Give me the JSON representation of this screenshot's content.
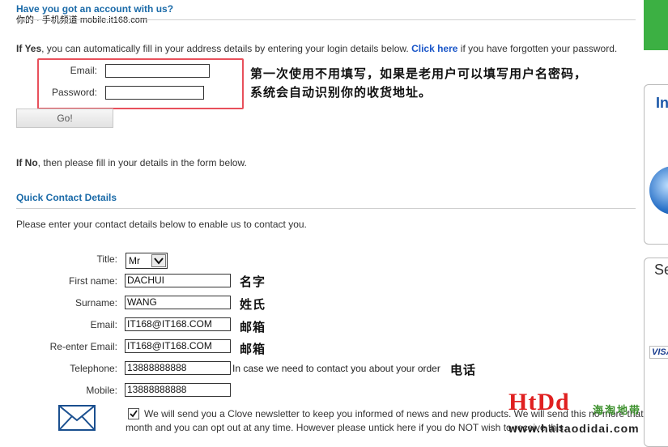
{
  "watermark": "你的 · 手机频道 mobile.it168.com",
  "account": {
    "heading": "Have you got an account with us?",
    "if_yes_bold": "If Yes",
    "if_yes_text": ", you can automatically fill in your address details by entering your login details below.",
    "click_here": "Click here",
    "forgot_text": "if you have forgotten your password.",
    "email_label": "Email:",
    "password_label": "Password:",
    "email_value": "",
    "password_value": "",
    "go_button": "Go!",
    "annotation_line1": "第一次使用不用填写，如果是老用户可以填写用户名密码，",
    "annotation_line2": "系统会自动识别你的收货地址。",
    "if_no_bold": "If No",
    "if_no_text": ", then please fill in your details in the form below."
  },
  "contact": {
    "heading": "Quick Contact Details",
    "intro": "Please enter your contact details below to enable us to contact you.",
    "title_label": "Title:",
    "title_value": "Mr",
    "firstname_label": "First name:",
    "firstname_value": "DACHUI",
    "firstname_note": "名字",
    "surname_label": "Surname:",
    "surname_value": "WANG",
    "surname_note": "姓氏",
    "email_label": "Email:",
    "email_value": "IT168@IT168.COM",
    "email_note": "邮箱",
    "reemail_label": "Re-enter Email:",
    "reemail_value": "IT168@IT168.COM",
    "reemail_note": "邮箱",
    "telephone_label": "Telephone:",
    "telephone_value": "13888888888",
    "telephone_hint": "In case we need to contact you about your order",
    "telephone_note": "电话",
    "mobile_label": "Mobile:",
    "mobile_value": "13888888888",
    "newsletter_checked": true,
    "newsletter_line1": "We will send you a Clove newsletter to keep you informed of news and new products. We will send this no more that once a",
    "newsletter_line2": "month and you can opt out at any time. However please untick here if you do NOT wish to receive this."
  },
  "sidebar": {
    "partial_in": "In",
    "partial_se": "Se",
    "visa": "VISA",
    "green_color": "#3cb043"
  },
  "logo": {
    "brand": "HtDd",
    "chinese": "海淘地带",
    "url": "www.haitaodidai.com",
    "brand_color": "#e02020",
    "chinese_color": "#3a8f2a"
  },
  "colors": {
    "heading_blue": "#1a6aa8",
    "link_blue": "#1a56c8",
    "annotation_red": "#e8505b"
  }
}
